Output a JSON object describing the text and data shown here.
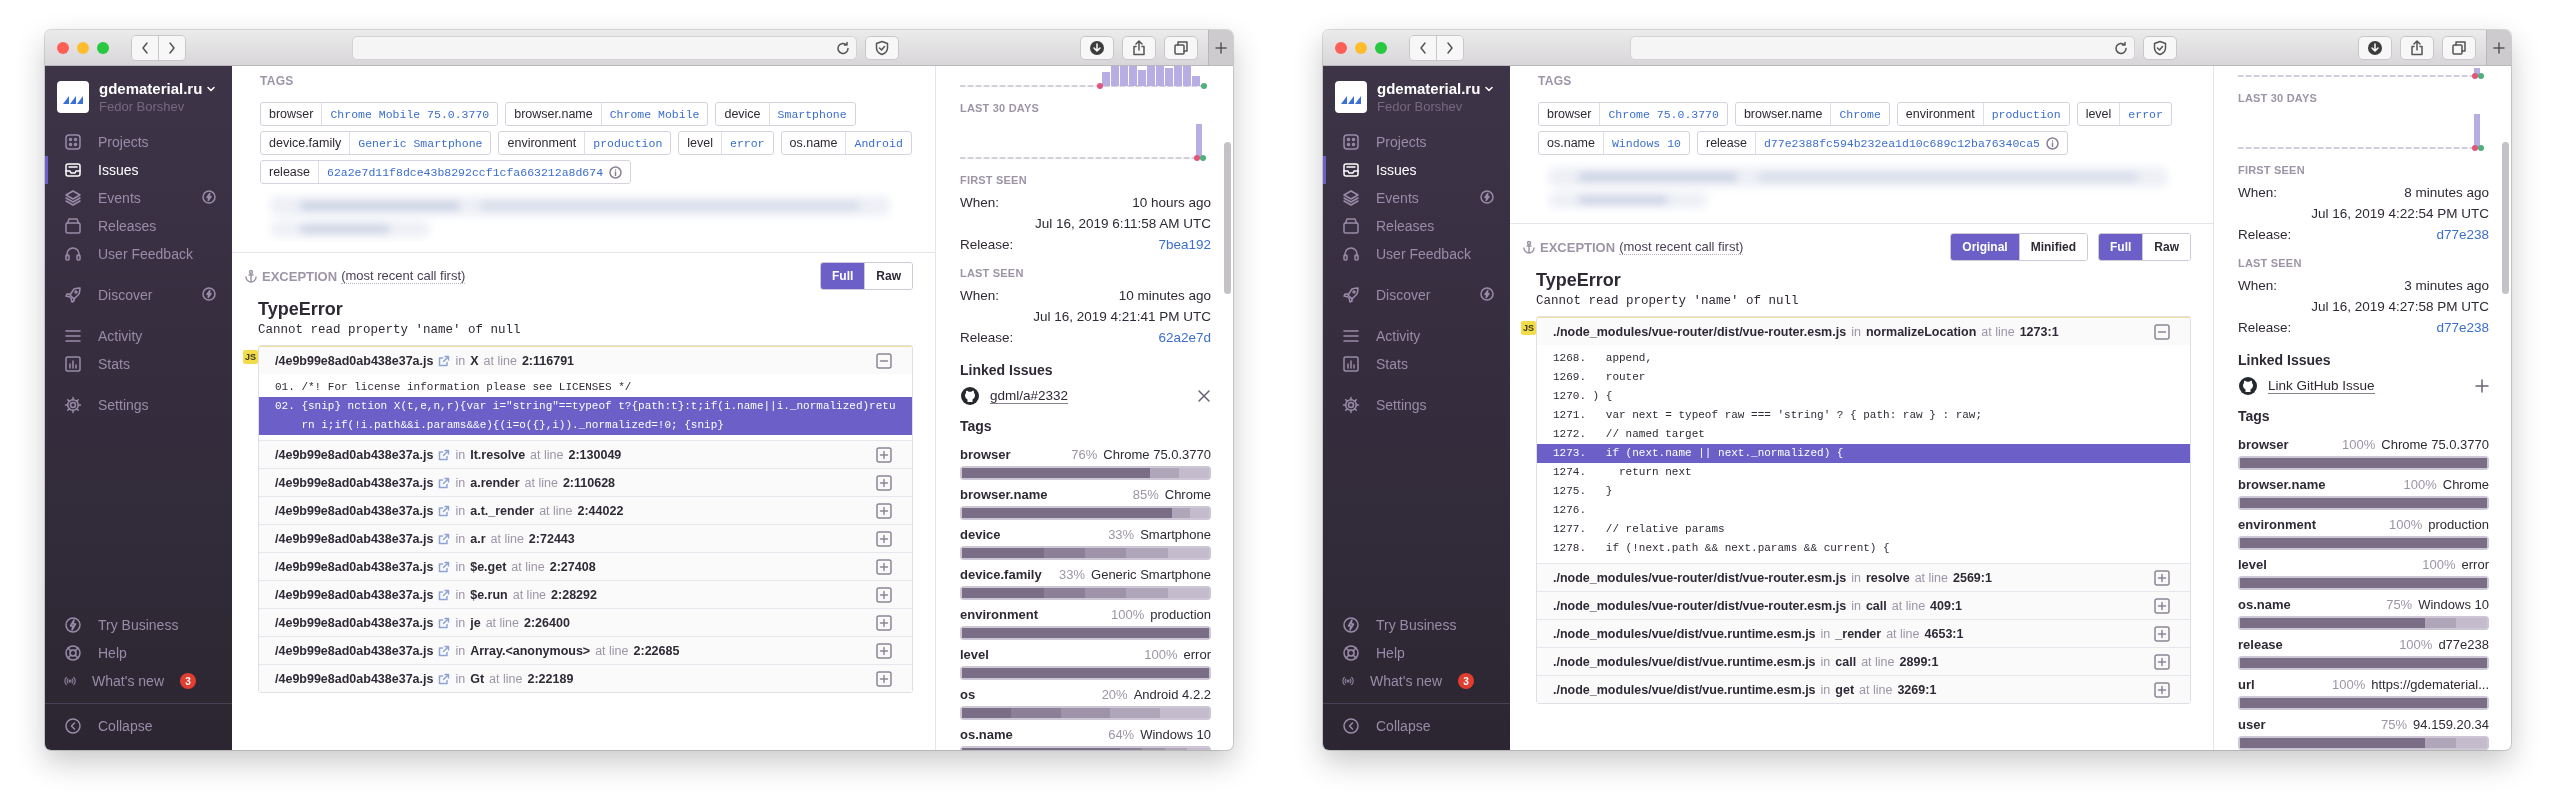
{
  "windows": [
    {
      "sidebar": {
        "org": "gdematerial.ru",
        "user": "Fedor Borshev",
        "nav_groups": [
          {
            "items": [
              {
                "label": "Projects",
                "selected": false,
                "new_icon": false
              },
              {
                "label": "Issues",
                "selected": true,
                "new_icon": false
              },
              {
                "label": "Events",
                "selected": false,
                "new_icon": true
              },
              {
                "label": "Releases",
                "selected": false,
                "new_icon": false
              },
              {
                "label": "User Feedback",
                "selected": false,
                "new_icon": false
              }
            ]
          },
          {
            "items": [
              {
                "label": "Discover",
                "selected": false,
                "new_icon": true
              }
            ]
          },
          {
            "items": [
              {
                "label": "Activity",
                "selected": false,
                "new_icon": false
              },
              {
                "label": "Stats",
                "selected": false,
                "new_icon": false
              }
            ]
          },
          {
            "items": [
              {
                "label": "Settings",
                "selected": false,
                "new_icon": false
              }
            ]
          }
        ],
        "footer_items": [
          {
            "label": "Try Business"
          },
          {
            "label": "Help"
          },
          {
            "label": "What's new",
            "badge": "3"
          },
          {
            "label": "Collapse"
          }
        ]
      },
      "tags": {
        "title": "TAGS",
        "items": [
          {
            "key": "browser",
            "value": "Chrome Mobile 75.0.3770",
            "info": false
          },
          {
            "key": "browser.name",
            "value": "Chrome Mobile",
            "info": false
          },
          {
            "key": "device",
            "value": "Smartphone",
            "info": false
          },
          {
            "key": "device.family",
            "value": "Generic Smartphone",
            "info": false
          },
          {
            "key": "environment",
            "value": "production",
            "info": false
          },
          {
            "key": "level",
            "value": "error",
            "info": false
          },
          {
            "key": "os.name",
            "value": "Android",
            "info": false
          },
          {
            "key": "release",
            "value": "62a2e7d11f8dce43b8292ccf1cfa663212a8d674",
            "info": true
          }
        ]
      },
      "exception": {
        "title": "EXCEPTION",
        "subtitle": "(most recent call first)",
        "toggle_groups": [
          {
            "options": [
              {
                "label": "Full",
                "selected": true
              },
              {
                "label": "Raw",
                "selected": false
              }
            ]
          }
        ],
        "type": "TypeError",
        "message": "Cannot read property 'name' of null",
        "frames": [
          {
            "badge": "JS",
            "file": "/4e9b99e8ad0ab438e37a.js",
            "external_link": true,
            "in_label": "in",
            "function": "X",
            "at_label": "at line",
            "line": "2:116791",
            "expanded": true,
            "code": [
              {
                "number": "01.",
                "text": "/*! For license information please see LICENSES */",
                "selected": false
              },
              {
                "number": "02.",
                "text": "{snip} nction X(t,e,n,r){var i=\"string\"==typeof t?{path:t}:t;if(i.name||i._normalized)return i;if(!i.path&&i.params&&e){(i=o({},i))._normalized=!0; {snip}",
                "selected": true
              }
            ]
          },
          {
            "file": "/4e9b99e8ad0ab438e37a.js",
            "external_link": true,
            "in_label": "in",
            "function": "It.resolve",
            "at_label": "at line",
            "line": "2:130049",
            "expanded": false
          },
          {
            "file": "/4e9b99e8ad0ab438e37a.js",
            "external_link": true,
            "in_label": "in",
            "function": "a.render",
            "at_label": "at line",
            "line": "2:110628",
            "expanded": false
          },
          {
            "file": "/4e9b99e8ad0ab438e37a.js",
            "external_link": true,
            "in_label": "in",
            "function": "a.t._render",
            "at_label": "at line",
            "line": "2:44022",
            "expanded": false
          },
          {
            "file": "/4e9b99e8ad0ab438e37a.js",
            "external_link": true,
            "in_label": "in",
            "function": "a.r",
            "at_label": "at line",
            "line": "2:72443",
            "expanded": false
          },
          {
            "file": "/4e9b99e8ad0ab438e37a.js",
            "external_link": true,
            "in_label": "in",
            "function": "$e.get",
            "at_label": "at line",
            "line": "2:27408",
            "expanded": false
          },
          {
            "file": "/4e9b99e8ad0ab438e37a.js",
            "external_link": true,
            "in_label": "in",
            "function": "$e.run",
            "at_label": "at line",
            "line": "2:28292",
            "expanded": false
          },
          {
            "file": "/4e9b99e8ad0ab438e37a.js",
            "external_link": true,
            "in_label": "in",
            "function": "je",
            "at_label": "at line",
            "line": "2:26400",
            "expanded": false
          },
          {
            "file": "/4e9b99e8ad0ab438e37a.js",
            "external_link": true,
            "in_label": "in",
            "function": "Array.<anonymous>",
            "at_label": "at line",
            "line": "2:22685",
            "expanded": false
          },
          {
            "file": "/4e9b99e8ad0ab438e37a.js",
            "external_link": true,
            "in_label": "in",
            "function": "Gt",
            "at_label": "at line",
            "line": "2:22189",
            "expanded": false
          }
        ]
      },
      "panel": {
        "charts": [
          {
            "kind": "dense"
          },
          {
            "kind": "sparse",
            "title": "LAST 30 DAYS"
          }
        ],
        "seen": [
          {
            "title": "FIRST SEEN",
            "when_label": "When:",
            "when": "10 hours ago",
            "date": "Jul 16, 2019 6:11:58 AM UTC",
            "release_label": "Release:",
            "release": "7bea192"
          },
          {
            "title": "LAST SEEN",
            "when_label": "When:",
            "when": "10 minutes ago",
            "date": "Jul 16, 2019 4:21:41 PM UTC",
            "release_label": "Release:",
            "release": "62a2e7d"
          }
        ],
        "linked_issues": {
          "title": "Linked Issues",
          "issue": "gdml/a#2332",
          "linked": true
        },
        "tags_title": "Tags",
        "tags": [
          {
            "name": "browser",
            "percent": "76%",
            "value": "Chrome 75.0.3770",
            "level": 0.76
          },
          {
            "name": "browser.name",
            "percent": "85%",
            "value": "Chrome",
            "level": 0.85
          },
          {
            "name": "device",
            "percent": "33%",
            "value": "Smartphone",
            "level": 0.33
          },
          {
            "name": "device.family",
            "percent": "33%",
            "value": "Generic Smartphone",
            "level": 0.33
          },
          {
            "name": "environment",
            "percent": "100%",
            "value": "production",
            "level": 1
          },
          {
            "name": "level",
            "percent": "100%",
            "value": "error",
            "level": 1
          },
          {
            "name": "os",
            "percent": "20%",
            "value": "Android 4.2.2",
            "level": 0.2
          },
          {
            "name": "os.name",
            "percent": "64%",
            "value": "Windows 10",
            "level": 0.64
          }
        ]
      }
    },
    {
      "sidebar": {
        "org": "gdematerial.ru",
        "user": "Fedor Borshev",
        "nav_groups": [
          {
            "items": [
              {
                "label": "Projects",
                "selected": false,
                "new_icon": false
              },
              {
                "label": "Issues",
                "selected": true,
                "new_icon": false
              },
              {
                "label": "Events",
                "selected": false,
                "new_icon": true
              },
              {
                "label": "Releases",
                "selected": false,
                "new_icon": false
              },
              {
                "label": "User Feedback",
                "selected": false,
                "new_icon": false
              }
            ]
          },
          {
            "items": [
              {
                "label": "Discover",
                "selected": false,
                "new_icon": true
              }
            ]
          },
          {
            "items": [
              {
                "label": "Activity",
                "selected": false,
                "new_icon": false
              },
              {
                "label": "Stats",
                "selected": false,
                "new_icon": false
              }
            ]
          },
          {
            "items": [
              {
                "label": "Settings",
                "selected": false,
                "new_icon": false
              }
            ]
          }
        ],
        "footer_items": [
          {
            "label": "Try Business"
          },
          {
            "label": "Help"
          },
          {
            "label": "What's new",
            "badge": "3"
          },
          {
            "label": "Collapse"
          }
        ]
      },
      "tags": {
        "title": "TAGS",
        "items": [
          {
            "key": "browser",
            "value": "Chrome 75.0.3770",
            "info": false
          },
          {
            "key": "browser.name",
            "value": "Chrome",
            "info": false
          },
          {
            "key": "environment",
            "value": "production",
            "info": false
          },
          {
            "key": "level",
            "value": "error",
            "info": false
          },
          {
            "key": "os.name",
            "value": "Windows 10",
            "info": false
          },
          {
            "key": "release",
            "value": "d77e2388fc594b232ea1d10c689c12ba76340ca5",
            "info": true
          }
        ]
      },
      "exception": {
        "title": "EXCEPTION",
        "subtitle": "(most recent call first)",
        "toggle_groups": [
          {
            "options": [
              {
                "label": "Original",
                "selected": true
              },
              {
                "label": "Minified",
                "selected": false
              }
            ]
          },
          {
            "options": [
              {
                "label": "Full",
                "selected": true
              },
              {
                "label": "Raw",
                "selected": false
              }
            ]
          }
        ],
        "type": "TypeError",
        "message": "Cannot read property 'name' of null",
        "frames": [
          {
            "badge": "JS",
            "file": "./node_modules/vue-router/dist/vue-router.esm.js",
            "external_link": false,
            "in_label": "in",
            "function": "normalizeLocation",
            "at_label": "at line",
            "line": "1273:1",
            "expanded": true,
            "code": [
              {
                "number": "1268.",
                "text": "  append,",
                "selected": false
              },
              {
                "number": "1269.",
                "text": "  router",
                "selected": false
              },
              {
                "number": "1270.",
                "text": ") {",
                "selected": false
              },
              {
                "number": "1271.",
                "text": "  var next = typeof raw === 'string' ? { path: raw } : raw;",
                "selected": false
              },
              {
                "number": "1272.",
                "text": "  // named target",
                "selected": false
              },
              {
                "number": "1273.",
                "text": "  if (next.name || next._normalized) {",
                "selected": true
              },
              {
                "number": "1274.",
                "text": "    return next",
                "selected": false
              },
              {
                "number": "1275.",
                "text": "  }",
                "selected": false
              },
              {
                "number": "1276.",
                "selected": false
              },
              {
                "number": "1277.",
                "text": "  // relative params",
                "selected": false
              },
              {
                "number": "1278.",
                "text": "  if (!next.path && next.params && current) {",
                "selected": false
              }
            ]
          },
          {
            "file": "./node_modules/vue-router/dist/vue-router.esm.js",
            "external_link": false,
            "in_label": "in",
            "function": "resolve",
            "at_label": "at line",
            "line": "2569:1",
            "expanded": false
          },
          {
            "file": "./node_modules/vue-router/dist/vue-router.esm.js",
            "external_link": false,
            "in_label": "in",
            "function": "call",
            "at_label": "at line",
            "line": "409:1",
            "expanded": false
          },
          {
            "file": "./node_modules/vue/dist/vue.runtime.esm.js",
            "external_link": false,
            "in_label": "in",
            "function": "_render",
            "at_label": "at line",
            "line": "4653:1",
            "expanded": false
          },
          {
            "file": "./node_modules/vue/dist/vue.runtime.esm.js",
            "external_link": false,
            "in_label": "in",
            "function": "call",
            "at_label": "at line",
            "line": "2899:1",
            "expanded": false
          },
          {
            "file": "./node_modules/vue/dist/vue.runtime.esm.js",
            "external_link": false,
            "in_label": "in",
            "function": "get",
            "at_label": "at line",
            "line": "3269:1",
            "expanded": false
          }
        ]
      },
      "panel": {
        "charts": [
          {
            "kind": "sparse"
          },
          {
            "kind": "sparse",
            "title": "LAST 30 DAYS"
          }
        ],
        "seen": [
          {
            "title": "FIRST SEEN",
            "when_label": "When:",
            "when": "8 minutes ago",
            "date": "Jul 16, 2019 4:22:54 PM UTC",
            "release_label": "Release:",
            "release": "d77e238"
          },
          {
            "title": "LAST SEEN",
            "when_label": "When:",
            "when": "3 minutes ago",
            "date": "Jul 16, 2019 4:27:58 PM UTC",
            "release_label": "Release:",
            "release": "d77e238"
          }
        ],
        "linked_issues": {
          "title": "Linked Issues",
          "issue": "Link GitHub Issue",
          "linked": false
        },
        "tags_title": "Tags",
        "tags": [
          {
            "name": "browser",
            "percent": "100%",
            "value": "Chrome 75.0.3770",
            "level": 1
          },
          {
            "name": "browser.name",
            "percent": "100%",
            "value": "Chrome",
            "level": 1
          },
          {
            "name": "environment",
            "percent": "100%",
            "value": "production",
            "level": 1
          },
          {
            "name": "level",
            "percent": "100%",
            "value": "error",
            "level": 1
          },
          {
            "name": "os.name",
            "percent": "75%",
            "value": "Windows 10",
            "level": 0.75
          },
          {
            "name": "release",
            "percent": "100%",
            "value": "d77e238",
            "level": 1
          },
          {
            "name": "url",
            "percent": "100%",
            "value": "https://gdematerial...",
            "level": 1
          },
          {
            "name": "user",
            "percent": "75%",
            "value": "94.159.20.34",
            "level": 0.75
          }
        ]
      }
    }
  ]
}
